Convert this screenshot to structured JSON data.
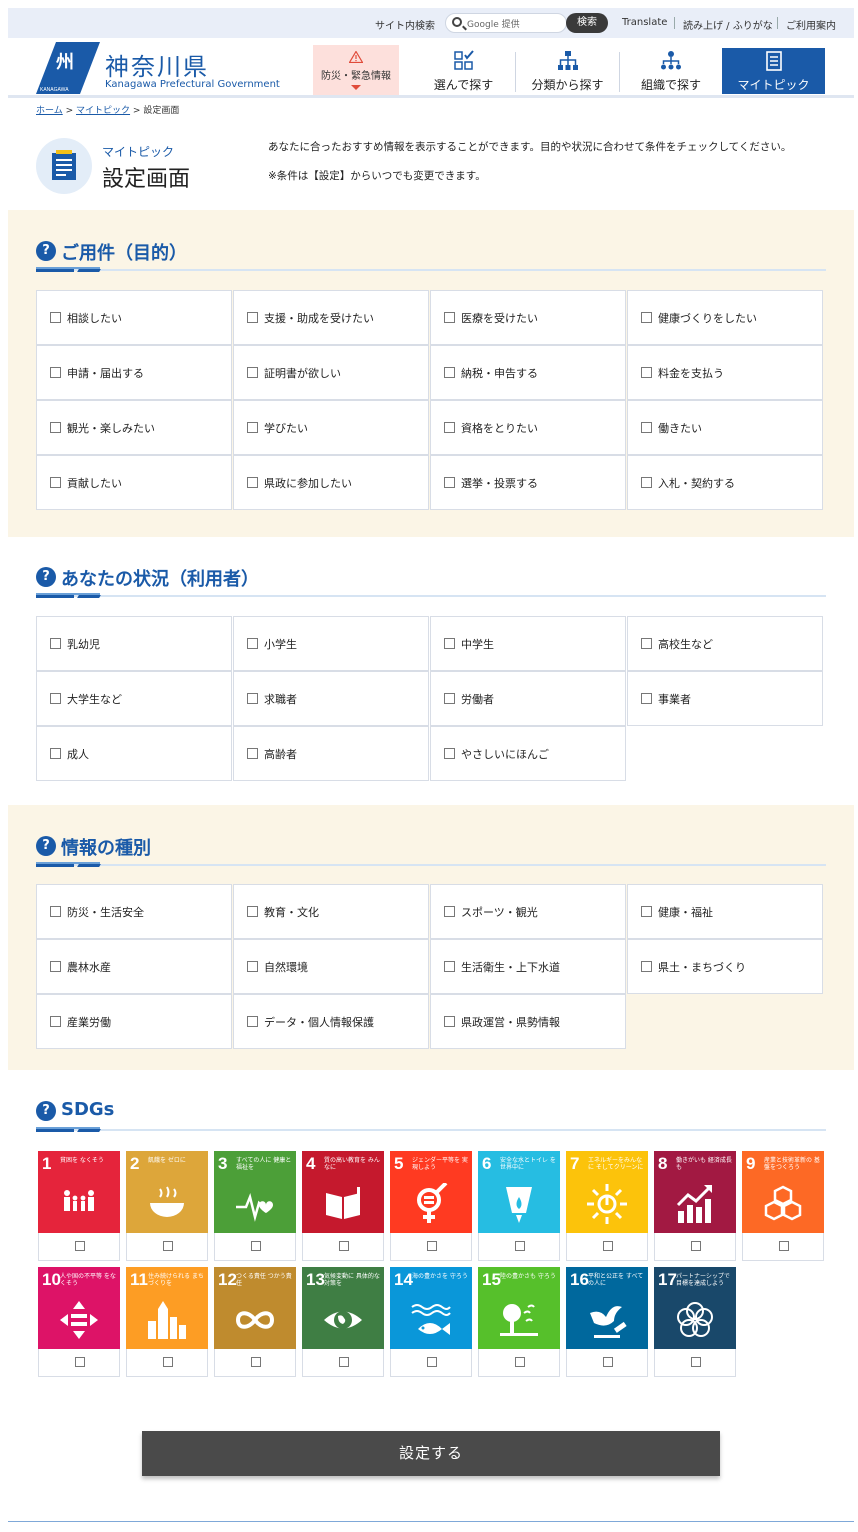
{
  "util": {
    "site_search_label": "サイト内検索",
    "search_placeholder": "Google 提供",
    "search_button": "検索",
    "translate": "Translate",
    "read_aloud": "読み上げ / ふりがな",
    "guide": "ご利用案内"
  },
  "header": {
    "logo_ja": "神奈川県",
    "logo_en": "Kanagawa Prefectural Government",
    "logo_mark_text": "KANAGAWA",
    "nav": [
      {
        "label": "防災・緊急情報",
        "icon": "warning-icon"
      },
      {
        "label": "選んで探す",
        "icon": "choose-icon"
      },
      {
        "label": "分類から探す",
        "icon": "category-icon"
      },
      {
        "label": "組織で探す",
        "icon": "organization-icon"
      },
      {
        "label": "マイトピック",
        "icon": "mytopic-icon"
      }
    ],
    "colors": {
      "brand": "#1a5aa8",
      "alert_bg": "#fde0dc"
    }
  },
  "breadcrumb": {
    "home": "ホーム",
    "mytopic": "マイトピック",
    "current": "設定画面",
    "sep": ">"
  },
  "page": {
    "sub": "マイトピック",
    "title": "設定画面",
    "intro1": "あなたに合ったおすすめ情報を表示することができます。目的や状況に合わせて条件をチェックしてください。",
    "intro2": "※条件は【設定】からいつでも変更できます。"
  },
  "sections": {
    "purpose": {
      "title": "ご用件（目的）",
      "items": [
        "相談したい",
        "支援・助成を受けたい",
        "医療を受けたい",
        "健康づくりをしたい",
        "申請・届出する",
        "証明書が欲しい",
        "納税・申告する",
        "料金を支払う",
        "観光・楽しみたい",
        "学びたい",
        "資格をとりたい",
        "働きたい",
        "貢献したい",
        "県政に参加したい",
        "選挙・投票する",
        "入札・契約する"
      ]
    },
    "status": {
      "title": "あなたの状況（利用者）",
      "items": [
        "乳幼児",
        "小学生",
        "中学生",
        "高校生など",
        "大学生など",
        "求職者",
        "労働者",
        "事業者",
        "成人",
        "高齢者",
        "やさしいにほんご"
      ]
    },
    "info": {
      "title": "情報の種別",
      "items": [
        "防災・生活安全",
        "教育・文化",
        "スポーツ・観光",
        "健康・福祉",
        "農林水産",
        "自然環境",
        "生活衛生・上下水道",
        "県土・まちづくり",
        "産業労働",
        "データ・個人情報保護",
        "県政運営・県勢情報"
      ]
    },
    "sdgs": {
      "title": "SDGs",
      "goals": [
        {
          "num": "1",
          "cap": "貧困を なくそう",
          "color": "#e5243b",
          "icon": "family-icon"
        },
        {
          "num": "2",
          "cap": "飢餓を ゼロに",
          "color": "#dda63a",
          "icon": "bowl-icon"
        },
        {
          "num": "3",
          "cap": "すべての人に 健康と福祉を",
          "color": "#4c9f38",
          "icon": "heartbeat-icon"
        },
        {
          "num": "4",
          "cap": "質の高い教育を みんなに",
          "color": "#c5192d",
          "icon": "book-icon"
        },
        {
          "num": "5",
          "cap": "ジェンダー平等を 実現しよう",
          "color": "#ff3a21",
          "icon": "gender-icon"
        },
        {
          "num": "6",
          "cap": "安全な水とトイレ を世界中に",
          "color": "#26bde2",
          "icon": "water-icon"
        },
        {
          "num": "7",
          "cap": "エネルギーをみんなに そしてクリーンに",
          "color": "#fcc30b",
          "icon": "sun-icon"
        },
        {
          "num": "8",
          "cap": "働きがいも 経済成長も",
          "color": "#a21942",
          "icon": "growth-icon"
        },
        {
          "num": "9",
          "cap": "産業と技術革新の 基盤をつくろう",
          "color": "#fd6925",
          "icon": "cubes-icon"
        },
        {
          "num": "10",
          "cap": "人や国の不平等 をなくそう",
          "color": "#dd1367",
          "icon": "equality-icon"
        },
        {
          "num": "11",
          "cap": "住み続けられる まちづくりを",
          "color": "#fd9d24",
          "icon": "city-icon"
        },
        {
          "num": "12",
          "cap": "つくる責任 つかう責任",
          "color": "#bf8b2e",
          "icon": "infinity-icon"
        },
        {
          "num": "13",
          "cap": "気候変動に 具体的な対策を",
          "color": "#3f7e44",
          "icon": "eye-globe-icon"
        },
        {
          "num": "14",
          "cap": "海の豊かさを 守ろう",
          "color": "#0a97d9",
          "icon": "fish-icon"
        },
        {
          "num": "15",
          "cap": "陸の豊かさも 守ろう",
          "color": "#56c02b",
          "icon": "tree-icon"
        },
        {
          "num": "16",
          "cap": "平和と公正を すべての人に",
          "color": "#00689d",
          "icon": "dove-icon"
        },
        {
          "num": "17",
          "cap": "パートナーシップで 目標を達成しよう",
          "color": "#19486a",
          "icon": "rings-icon"
        }
      ]
    }
  },
  "submit": "設定する"
}
